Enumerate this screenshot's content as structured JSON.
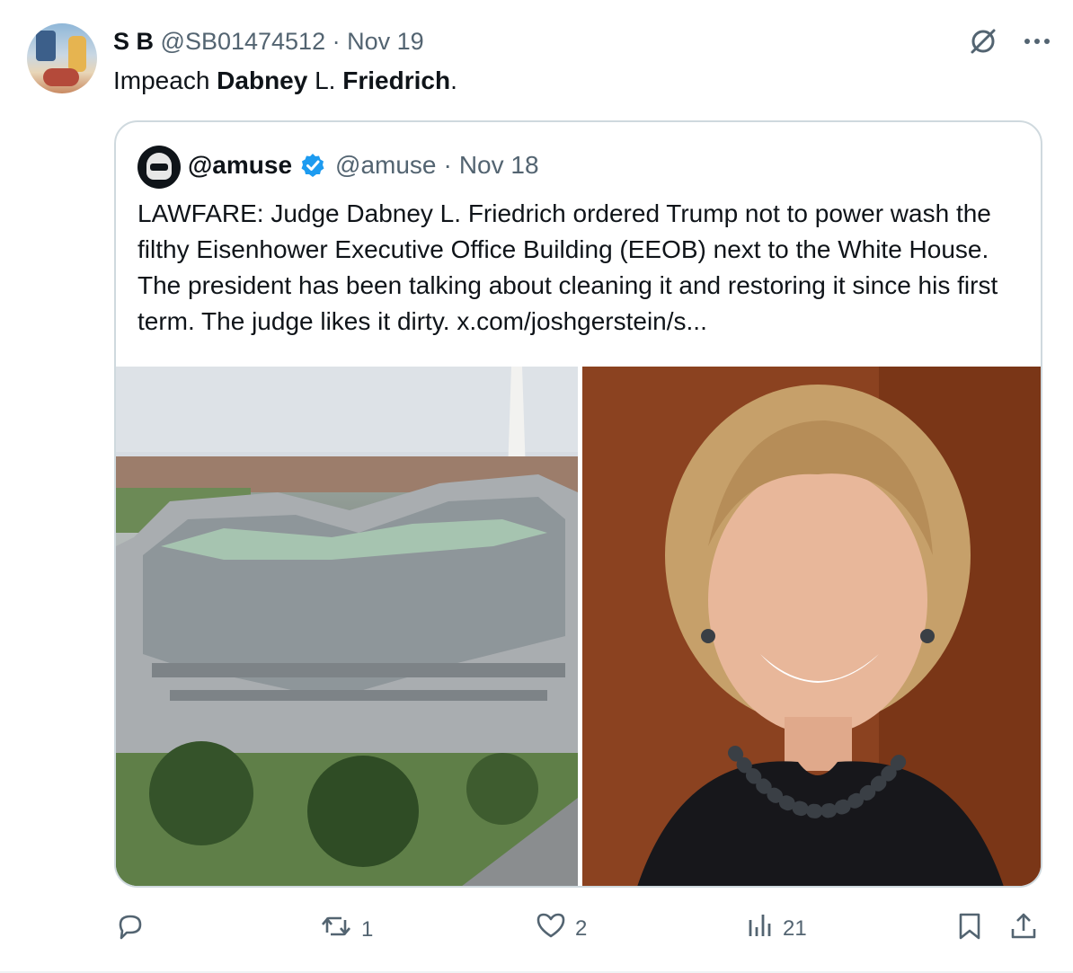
{
  "tweet": {
    "display_name": "S B",
    "handle": "@SB01474512",
    "separator": "·",
    "date": "Nov 19",
    "text_parts": [
      "Impeach ",
      "Dabney",
      " L. ",
      "Friedrich",
      "."
    ]
  },
  "quoted": {
    "display_name": "@amuse",
    "handle": "@amuse",
    "separator": "·",
    "date": "Nov 18",
    "text": "LAWFARE: Judge Dabney L. Friedrich ordered Trump not to power wash the filthy Eisenhower Executive Office Building (EEOB) next to the White House. The president has been talking about cleaning it and restoring it since his first term. The judge likes it dirty.  x.com/joshgerstein/s..."
  },
  "actions": {
    "replies": "",
    "reposts": "1",
    "likes": "2",
    "views": "21"
  },
  "icons": {
    "grok": "grok-icon",
    "more": "more-icon",
    "verified": "verified-badge-icon",
    "reply": "reply-icon",
    "repost": "repost-icon",
    "like": "like-icon",
    "views": "views-icon",
    "bookmark": "bookmark-icon",
    "share": "share-icon"
  },
  "colors": {
    "text": "#0f1419",
    "muted": "#536471",
    "verified": "#1d9bf0",
    "border": "#cfd9de"
  }
}
